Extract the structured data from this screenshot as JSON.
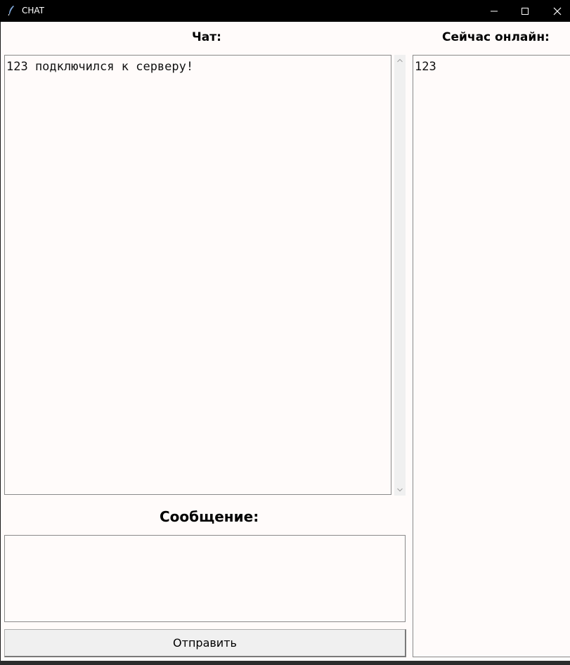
{
  "window": {
    "title": "CHAT",
    "icon": "feather-icon"
  },
  "labels": {
    "chat": "Чат:",
    "online": "Сейчас онлайн:",
    "message": "Сообщение:"
  },
  "chat": {
    "messages": [
      "123 подключился к серверу!"
    ]
  },
  "online": {
    "users": [
      "123"
    ]
  },
  "message_input": {
    "value": ""
  },
  "send_button": {
    "label": "Отправить"
  },
  "colors": {
    "background": "#fffbfa",
    "titlebar": "#000000",
    "button": "#f0f0f0"
  }
}
